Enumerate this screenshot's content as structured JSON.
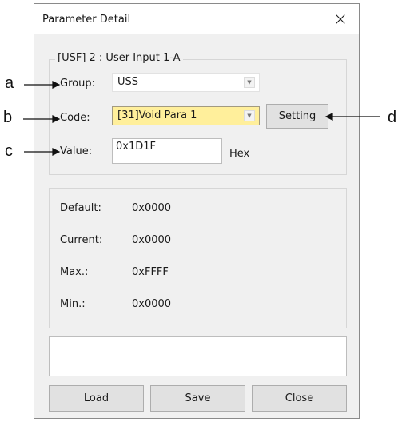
{
  "window": {
    "title": "Parameter Detail"
  },
  "param": {
    "header": "[USF] 2 : User Input 1-A",
    "group_label": "Group:",
    "group_value": "USS",
    "code_label": "Code:",
    "code_value": "[31]Void Para  1",
    "setting_label": "Setting",
    "value_label": "Value:",
    "value_text": "0x1D1F",
    "value_unit": "Hex"
  },
  "info": {
    "rows": [
      {
        "label": "Default:",
        "value": "0x0000"
      },
      {
        "label": "Current:",
        "value": "0x0000"
      },
      {
        "label": "Max.:",
        "value": "0xFFFF"
      },
      {
        "label": "Min.:",
        "value": "0x0000"
      }
    ]
  },
  "status": {
    "text": ""
  },
  "buttons": {
    "load": "Load",
    "save": "Save",
    "close": "Close"
  },
  "callouts": {
    "a": "a",
    "b": "b",
    "c": "c",
    "d": "d"
  },
  "colors": {
    "code_highlight": "#ffef9b",
    "window_bg": "#f0f0f0"
  }
}
